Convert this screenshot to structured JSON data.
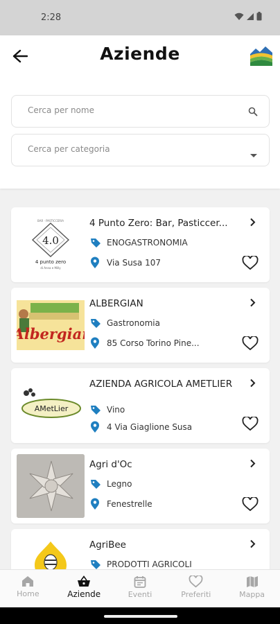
{
  "status": {
    "time": "2:28"
  },
  "header": {
    "title": "Aziende"
  },
  "search": {
    "placeholder": "Cerca  per nome"
  },
  "category": {
    "placeholder": "Cerca  per categoria"
  },
  "companies": [
    {
      "name": "4 Punto Zero: Bar, Pasticcer...",
      "category": "ENOGASTRONOMIA",
      "address": "Via Susa 107",
      "logo_text": "4.0",
      "logo_caption": "4 punto zero",
      "logo_small": "di Anna e Milly"
    },
    {
      "name": "ALBERGIAN",
      "category": "Gastronomia",
      "address": "85 Corso Torino Pine...",
      "logo_text": "Albergian"
    },
    {
      "name": "AZIENDA AGRICOLA AMETLIER",
      "category": "Vino",
      "address": "4 Via Giaglione Susa",
      "logo_text": "AMetLier"
    },
    {
      "name": "Agri d'Oc",
      "category": "Legno",
      "address": "Fenestrelle"
    },
    {
      "name": "AgriBee",
      "category": "PRODOTTI AGRICOLI",
      "address": ""
    }
  ],
  "tabs": [
    {
      "label": "Home",
      "icon": "home-icon"
    },
    {
      "label": "Aziende",
      "icon": "basket-icon"
    },
    {
      "label": "Eventi",
      "icon": "calendar-icon"
    },
    {
      "label": "Preferiti",
      "icon": "heart-icon"
    },
    {
      "label": "Mappa",
      "icon": "map-icon"
    }
  ],
  "colors": {
    "accent_blue": "#1f7fc0",
    "active_tab": "#111111",
    "inactive_tab": "#a6a6a6"
  }
}
